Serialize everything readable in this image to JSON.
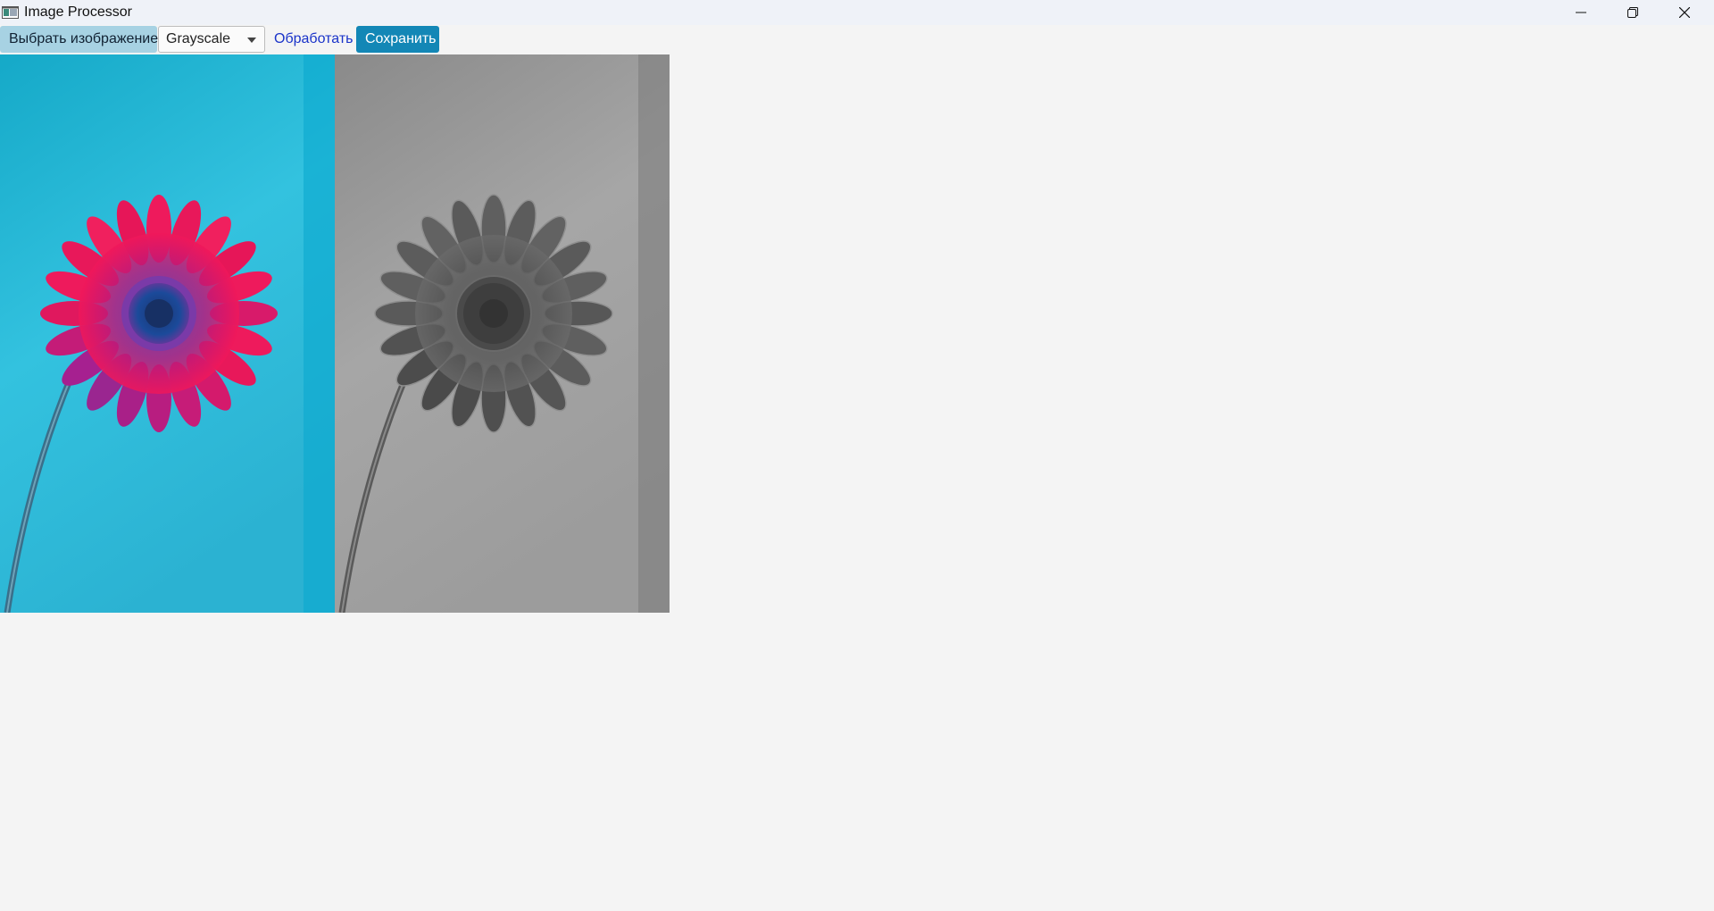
{
  "window": {
    "title": "Image Processor"
  },
  "toolbar": {
    "choose_label": "Выбрать изображение",
    "filter_selected": "Grayscale",
    "process_label": "Обработать",
    "save_label": "Сохранить"
  },
  "colors": {
    "choose_button_bg": "#a7d2e3",
    "save_button_bg": "#1387b6",
    "process_text": "#1a33c9",
    "original_background": "#1cb8d8",
    "flower_petals": "#e0175f",
    "flower_center": "#1a3f8f",
    "processed_background": "#9a9a9a"
  },
  "icons": {
    "app": "app-window-icon",
    "minimize": "minimize-icon",
    "maximize": "restore-icon",
    "close": "close-icon",
    "dropdown": "chevron-down-icon"
  }
}
